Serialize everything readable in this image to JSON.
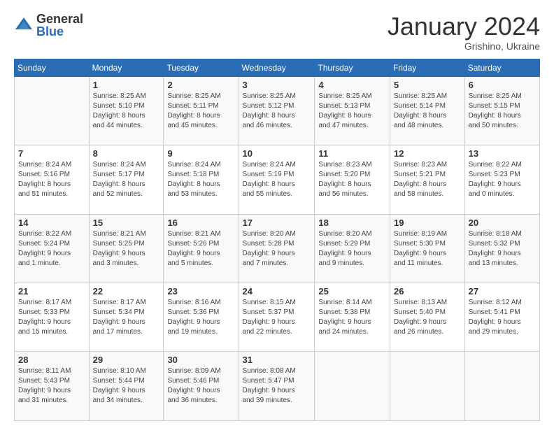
{
  "header": {
    "logo_general": "General",
    "logo_blue": "Blue",
    "month_title": "January 2024",
    "location": "Grishino, Ukraine"
  },
  "weekdays": [
    "Sunday",
    "Monday",
    "Tuesday",
    "Wednesday",
    "Thursday",
    "Friday",
    "Saturday"
  ],
  "weeks": [
    [
      {
        "day": "",
        "info": ""
      },
      {
        "day": "1",
        "info": "Sunrise: 8:25 AM\nSunset: 5:10 PM\nDaylight: 8 hours\nand 44 minutes."
      },
      {
        "day": "2",
        "info": "Sunrise: 8:25 AM\nSunset: 5:11 PM\nDaylight: 8 hours\nand 45 minutes."
      },
      {
        "day": "3",
        "info": "Sunrise: 8:25 AM\nSunset: 5:12 PM\nDaylight: 8 hours\nand 46 minutes."
      },
      {
        "day": "4",
        "info": "Sunrise: 8:25 AM\nSunset: 5:13 PM\nDaylight: 8 hours\nand 47 minutes."
      },
      {
        "day": "5",
        "info": "Sunrise: 8:25 AM\nSunset: 5:14 PM\nDaylight: 8 hours\nand 48 minutes."
      },
      {
        "day": "6",
        "info": "Sunrise: 8:25 AM\nSunset: 5:15 PM\nDaylight: 8 hours\nand 50 minutes."
      }
    ],
    [
      {
        "day": "7",
        "info": "Sunrise: 8:24 AM\nSunset: 5:16 PM\nDaylight: 8 hours\nand 51 minutes."
      },
      {
        "day": "8",
        "info": "Sunrise: 8:24 AM\nSunset: 5:17 PM\nDaylight: 8 hours\nand 52 minutes."
      },
      {
        "day": "9",
        "info": "Sunrise: 8:24 AM\nSunset: 5:18 PM\nDaylight: 8 hours\nand 53 minutes."
      },
      {
        "day": "10",
        "info": "Sunrise: 8:24 AM\nSunset: 5:19 PM\nDaylight: 8 hours\nand 55 minutes."
      },
      {
        "day": "11",
        "info": "Sunrise: 8:23 AM\nSunset: 5:20 PM\nDaylight: 8 hours\nand 56 minutes."
      },
      {
        "day": "12",
        "info": "Sunrise: 8:23 AM\nSunset: 5:21 PM\nDaylight: 8 hours\nand 58 minutes."
      },
      {
        "day": "13",
        "info": "Sunrise: 8:22 AM\nSunset: 5:23 PM\nDaylight: 9 hours\nand 0 minutes."
      }
    ],
    [
      {
        "day": "14",
        "info": "Sunrise: 8:22 AM\nSunset: 5:24 PM\nDaylight: 9 hours\nand 1 minute."
      },
      {
        "day": "15",
        "info": "Sunrise: 8:21 AM\nSunset: 5:25 PM\nDaylight: 9 hours\nand 3 minutes."
      },
      {
        "day": "16",
        "info": "Sunrise: 8:21 AM\nSunset: 5:26 PM\nDaylight: 9 hours\nand 5 minutes."
      },
      {
        "day": "17",
        "info": "Sunrise: 8:20 AM\nSunset: 5:28 PM\nDaylight: 9 hours\nand 7 minutes."
      },
      {
        "day": "18",
        "info": "Sunrise: 8:20 AM\nSunset: 5:29 PM\nDaylight: 9 hours\nand 9 minutes."
      },
      {
        "day": "19",
        "info": "Sunrise: 8:19 AM\nSunset: 5:30 PM\nDaylight: 9 hours\nand 11 minutes."
      },
      {
        "day": "20",
        "info": "Sunrise: 8:18 AM\nSunset: 5:32 PM\nDaylight: 9 hours\nand 13 minutes."
      }
    ],
    [
      {
        "day": "21",
        "info": "Sunrise: 8:17 AM\nSunset: 5:33 PM\nDaylight: 9 hours\nand 15 minutes."
      },
      {
        "day": "22",
        "info": "Sunrise: 8:17 AM\nSunset: 5:34 PM\nDaylight: 9 hours\nand 17 minutes."
      },
      {
        "day": "23",
        "info": "Sunrise: 8:16 AM\nSunset: 5:36 PM\nDaylight: 9 hours\nand 19 minutes."
      },
      {
        "day": "24",
        "info": "Sunrise: 8:15 AM\nSunset: 5:37 PM\nDaylight: 9 hours\nand 22 minutes."
      },
      {
        "day": "25",
        "info": "Sunrise: 8:14 AM\nSunset: 5:38 PM\nDaylight: 9 hours\nand 24 minutes."
      },
      {
        "day": "26",
        "info": "Sunrise: 8:13 AM\nSunset: 5:40 PM\nDaylight: 9 hours\nand 26 minutes."
      },
      {
        "day": "27",
        "info": "Sunrise: 8:12 AM\nSunset: 5:41 PM\nDaylight: 9 hours\nand 29 minutes."
      }
    ],
    [
      {
        "day": "28",
        "info": "Sunrise: 8:11 AM\nSunset: 5:43 PM\nDaylight: 9 hours\nand 31 minutes."
      },
      {
        "day": "29",
        "info": "Sunrise: 8:10 AM\nSunset: 5:44 PM\nDaylight: 9 hours\nand 34 minutes."
      },
      {
        "day": "30",
        "info": "Sunrise: 8:09 AM\nSunset: 5:46 PM\nDaylight: 9 hours\nand 36 minutes."
      },
      {
        "day": "31",
        "info": "Sunrise: 8:08 AM\nSunset: 5:47 PM\nDaylight: 9 hours\nand 39 minutes."
      },
      {
        "day": "",
        "info": ""
      },
      {
        "day": "",
        "info": ""
      },
      {
        "day": "",
        "info": ""
      }
    ]
  ]
}
